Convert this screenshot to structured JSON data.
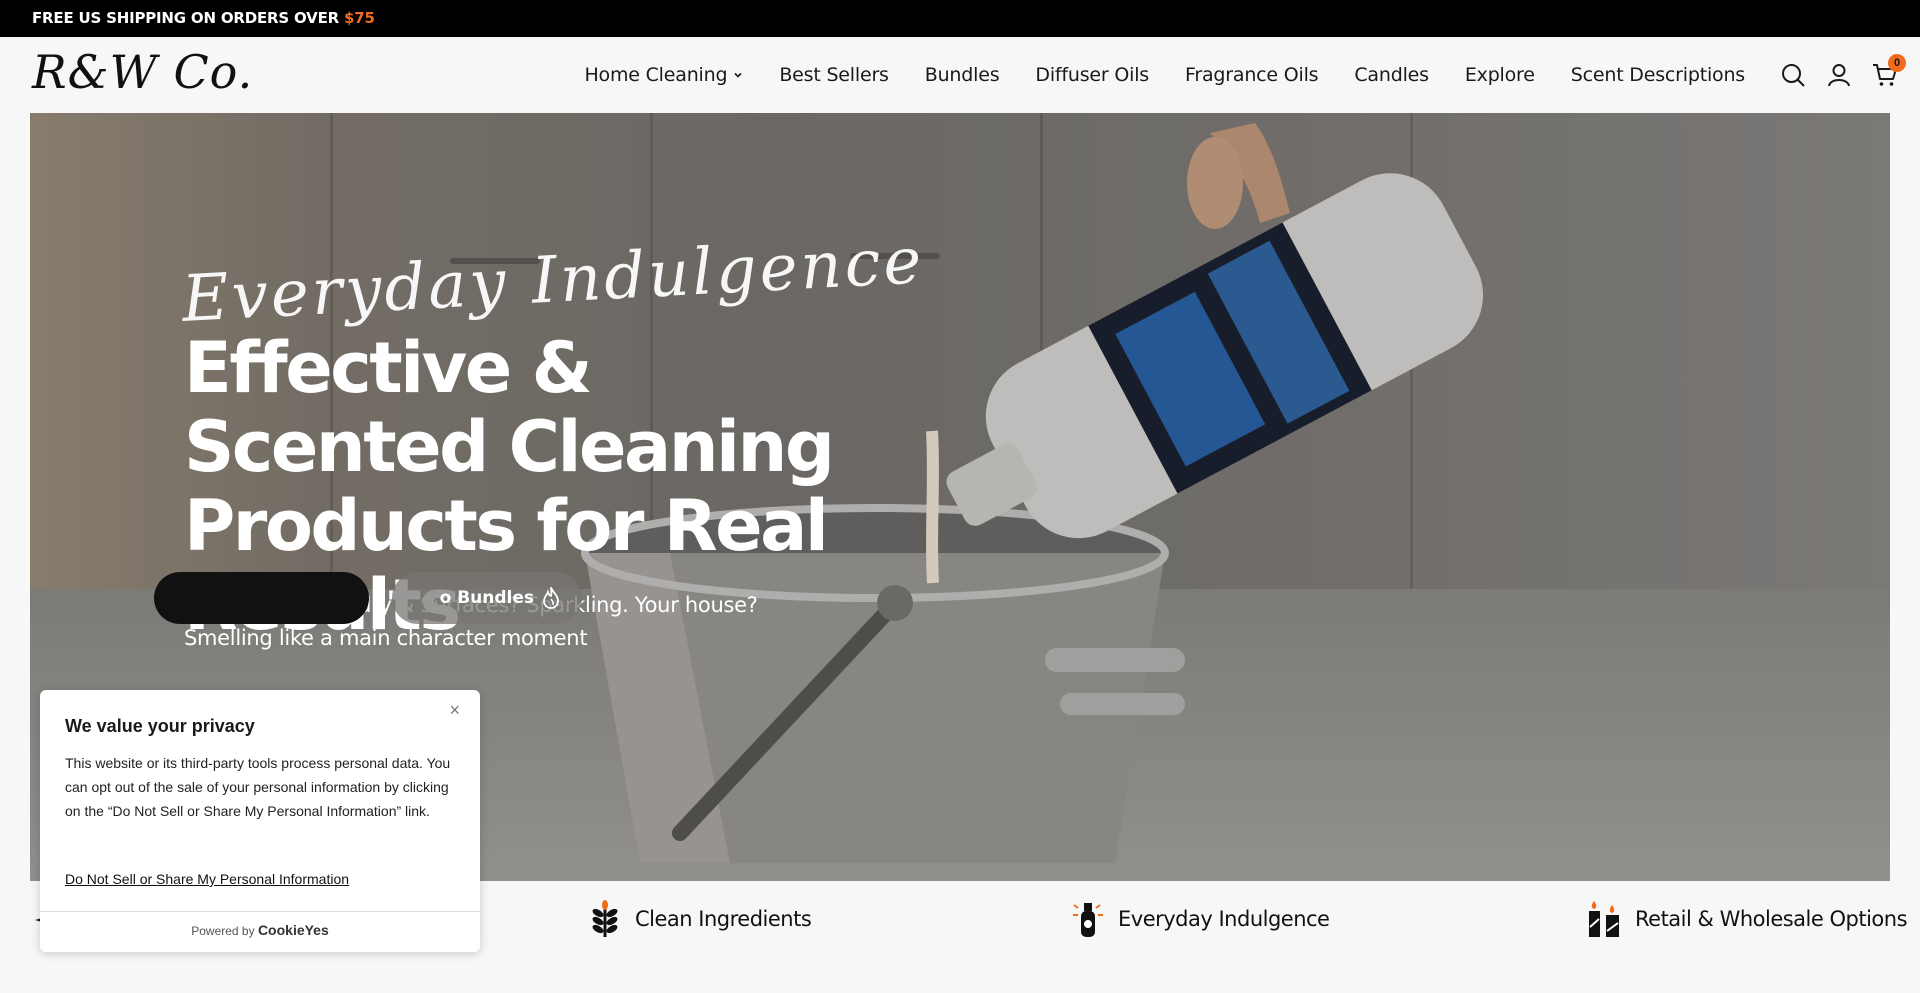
{
  "announcement": {
    "text": "FREE US SHIPPING ON ORDERS OVER ",
    "amount": "$75"
  },
  "header": {
    "logo": "R&W Co.",
    "nav": [
      {
        "label": "Home Cleaning",
        "has_dropdown": true
      },
      {
        "label": "Best Sellers"
      },
      {
        "label": "Bundles"
      },
      {
        "label": "Diffuser Oils"
      },
      {
        "label": "Fragrance Oils"
      },
      {
        "label": "Candles"
      },
      {
        "label": "Explore"
      },
      {
        "label": "Scent Descriptions"
      }
    ],
    "icons": [
      "search-icon",
      "account-icon",
      "cart-icon"
    ],
    "cart_count": "0"
  },
  "hero": {
    "script_text": "Everyday Indulgence",
    "headline": "Effective & Scented Cleaning Products for Real Results",
    "subtitle": "Your Floors, Laundry & Surfaces? Sparkling. Your house? Smelling like a main character moment",
    "secondary_button": "Shop Bundles",
    "secondary_button_visible": "o Bundles"
  },
  "features": [
    {
      "label": "Clean Ingredients",
      "icon": "wheat-icon"
    },
    {
      "label": "Everyday Indulgence",
      "icon": "spray-bottle-icon"
    },
    {
      "label": "Retail & Wholesale Options",
      "icon": "candles-icon"
    }
  ],
  "cookie_banner": {
    "title": "We value your privacy",
    "body": "This website or its third-party tools process personal data. You can opt out of the sale of your personal information by clicking on the “Do Not Sell or Share My Personal Information” link.",
    "link": "Do Not Sell or Share My Personal Information",
    "powered_by": "Powered by",
    "brand": "CookieYes",
    "close": "×"
  },
  "colors": {
    "accent": "#f26a1b",
    "dark": "#111111"
  }
}
